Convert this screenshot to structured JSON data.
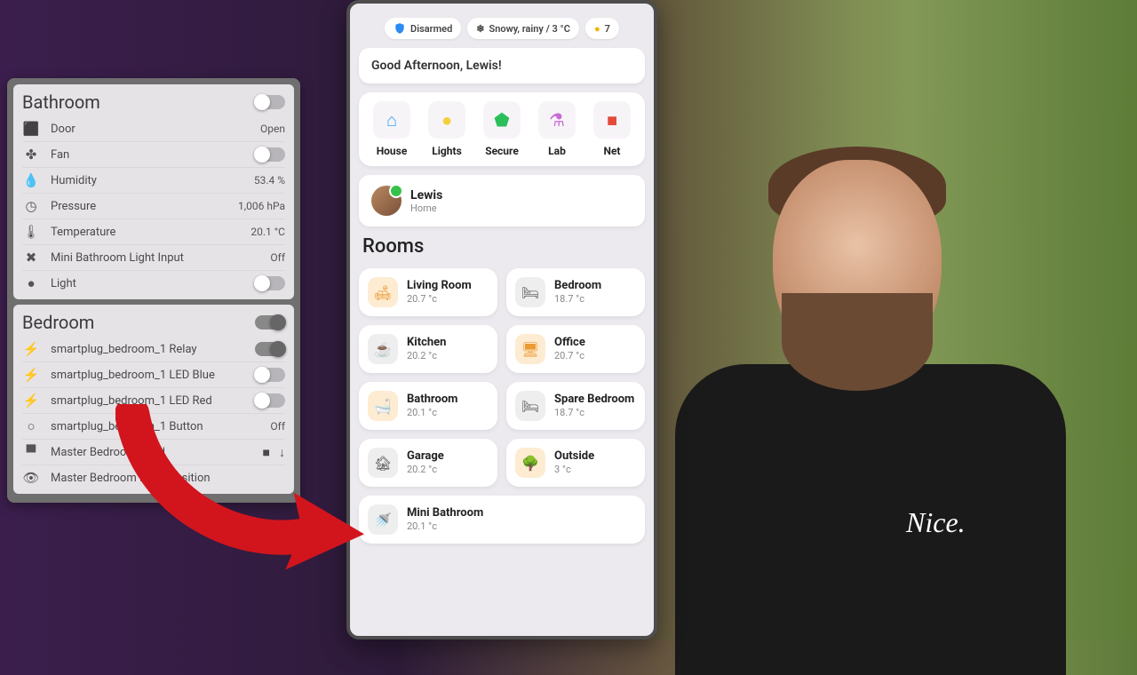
{
  "left": {
    "bathroom_title": "Bathroom",
    "bathroom": [
      {
        "icon": "door-icon",
        "glyph": "⬛",
        "label": "Door",
        "value": "Open",
        "ctrl": "text"
      },
      {
        "icon": "fan-icon",
        "glyph": "✤",
        "label": "Fan",
        "ctrl": "toggle",
        "on": false
      },
      {
        "icon": "humidity-icon",
        "glyph": "💧",
        "label": "Humidity",
        "value": "53.4 %",
        "ctrl": "text"
      },
      {
        "icon": "pressure-icon",
        "glyph": "◷",
        "label": "Pressure",
        "value": "1,006 hPa",
        "ctrl": "text"
      },
      {
        "icon": "thermometer-icon",
        "glyph": "🌡",
        "label": "Temperature",
        "value": "20.1 °C",
        "ctrl": "text"
      },
      {
        "icon": "light-off-icon",
        "glyph": "✖",
        "label": "Mini Bathroom Light Input",
        "value": "Off",
        "ctrl": "text"
      },
      {
        "icon": "bulb-icon",
        "glyph": "●",
        "label": "Light",
        "ctrl": "toggle",
        "on": false
      }
    ],
    "bedroom_title": "Bedroom",
    "bedroom": [
      {
        "icon": "bolt-icon",
        "glyph": "⚡",
        "label": "smartplug_bedroom_1 Relay",
        "ctrl": "toggle",
        "on": true
      },
      {
        "icon": "bolt-icon",
        "glyph": "⚡",
        "label": "smartplug_bedroom_1 LED Blue",
        "ctrl": "toggle",
        "on": false
      },
      {
        "icon": "bolt-icon",
        "glyph": "⚡",
        "label": "smartplug_bedroom_1 LED Red",
        "ctrl": "toggle",
        "on": false
      },
      {
        "icon": "circle-icon",
        "glyph": "○",
        "label": "smartplug_bedroom_1 Button",
        "value": "Off",
        "ctrl": "text"
      },
      {
        "icon": "blind-icon",
        "glyph": "▀",
        "label": "Master Bedroom Blind",
        "ctrl": "blind"
      },
      {
        "icon": "eye-icon",
        "glyph": "👁",
        "label": "Master Bedroom Blind Position",
        "ctrl": "none"
      }
    ]
  },
  "phone": {
    "status": {
      "alarm_icon": "#2a8bf2",
      "alarm": "Disarmed",
      "weather": "Snowy, rainy / 3 °C",
      "lights_count": "7"
    },
    "greeting": "Good Afternoon, Lewis!",
    "tiles": [
      {
        "name": "house",
        "label": "House",
        "color": "#36a3ff",
        "glyph": "⌂"
      },
      {
        "name": "lights",
        "label": "Lights",
        "color": "#f4cf3a",
        "glyph": "●"
      },
      {
        "name": "secure",
        "label": "Secure",
        "color": "#2bbf5a",
        "glyph": "⬟"
      },
      {
        "name": "lab",
        "label": "Lab",
        "color": "#c96bd6",
        "glyph": "⚗"
      },
      {
        "name": "net",
        "label": "Net",
        "color": "#e34a3a",
        "glyph": "■"
      }
    ],
    "user": {
      "name": "Lewis",
      "location": "Home"
    },
    "rooms_title": "Rooms",
    "rooms": [
      {
        "name": "Living Room",
        "temp": "20.7 °c",
        "warm": true,
        "glyph": "🛋"
      },
      {
        "name": "Bedroom",
        "temp": "18.7 °c",
        "warm": false,
        "glyph": "🛏"
      },
      {
        "name": "Kitchen",
        "temp": "20.2 °c",
        "warm": false,
        "glyph": "☕"
      },
      {
        "name": "Office",
        "temp": "20.7 °c",
        "warm": true,
        "glyph": "🖥"
      },
      {
        "name": "Bathroom",
        "temp": "20.1 °c",
        "warm": true,
        "glyph": "🛁"
      },
      {
        "name": "Spare Bedroom",
        "temp": "18.7 °c",
        "warm": false,
        "glyph": "🛏"
      },
      {
        "name": "Garage",
        "temp": "20.2 °c",
        "warm": false,
        "glyph": "🏚"
      },
      {
        "name": "Outside",
        "temp": "3 °c",
        "warm": true,
        "glyph": "🌳"
      },
      {
        "name": "Mini Bathroom",
        "temp": "20.1 °c",
        "warm": false,
        "glyph": "🚿",
        "wide": true
      }
    ]
  },
  "shirt": "Nice."
}
